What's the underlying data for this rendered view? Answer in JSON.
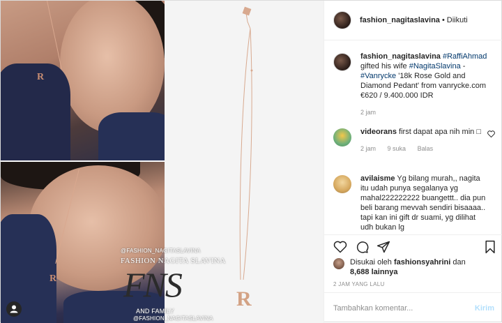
{
  "post": {
    "owner": "fashion_nagitaslavina",
    "separator": "•",
    "follow_state": "Diikuti"
  },
  "photo": {
    "watermark_handle_top": "@FASHION_NAGITASLAVINA",
    "watermark_name": "FASHION NAGITA SLAVINA",
    "watermark_logo": "FNS",
    "watermark_sub": "AND FAMILY",
    "watermark_handle_bottom": "@FASHION_NAGITASLAVINA",
    "pendant_letter": "R"
  },
  "caption": {
    "user": "fashion_nagitaslavina",
    "tag1": "#RaffiAhmad",
    "text1": "gifted his wife",
    "tag2": "#NagitaSlavina",
    "sep": "-",
    "tag3": "#Vanrycke",
    "text2": "'18k Rose Gold and Diamond Pedant' from vanrycke.com €620 / 9.400.000 IDR",
    "time": "2 jam"
  },
  "comments": [
    {
      "user": "videorans",
      "text": "first dapat apa nih min □",
      "time": "2 jam",
      "likes": "9 suka",
      "reply": "Balas"
    },
    {
      "user": "avilaisme",
      "text": "Yg bilang murah,, nagita itu udah punya segalanya yg mahal222222222 buangettt.. dia pun beli barang mevvah sendiri bisaaaa.. tapi kan ini gift dr suami, yg dilihat udh bukan lg"
    }
  ],
  "likes": {
    "prefix": "Disukai oleh",
    "user": "fashionsyahrini",
    "and": "dan",
    "count": "8,688 lainnya"
  },
  "timestamp": "2 JAM YANG LALU",
  "composer": {
    "placeholder": "Tambahkan komentar...",
    "send": "Kirim"
  },
  "icons": [
    "heart-icon",
    "comment-icon",
    "share-icon",
    "bookmark-icon",
    "user-tag-icon"
  ]
}
